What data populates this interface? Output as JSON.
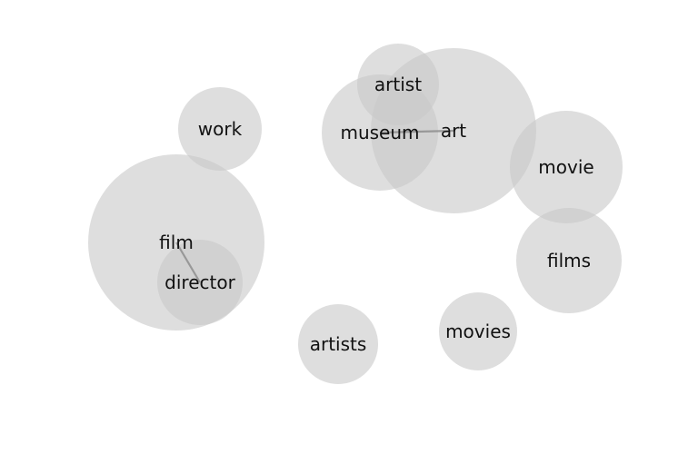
{
  "diagram": {
    "bubble_color": "#c8c8c8",
    "link_color": "#8a8a8a",
    "text_color": "#111111",
    "nodes": [
      {
        "id": "film",
        "label": "film"
      },
      {
        "id": "director",
        "label": "director"
      },
      {
        "id": "work",
        "label": "work"
      },
      {
        "id": "art",
        "label": "art"
      },
      {
        "id": "museum",
        "label": "museum"
      },
      {
        "id": "artist",
        "label": "artist"
      },
      {
        "id": "movie",
        "label": "movie"
      },
      {
        "id": "films",
        "label": "films"
      },
      {
        "id": "artists",
        "label": "artists"
      },
      {
        "id": "movies",
        "label": "movies"
      }
    ],
    "links": [
      {
        "source": "film",
        "target": "director"
      },
      {
        "source": "museum",
        "target": "art"
      }
    ]
  }
}
